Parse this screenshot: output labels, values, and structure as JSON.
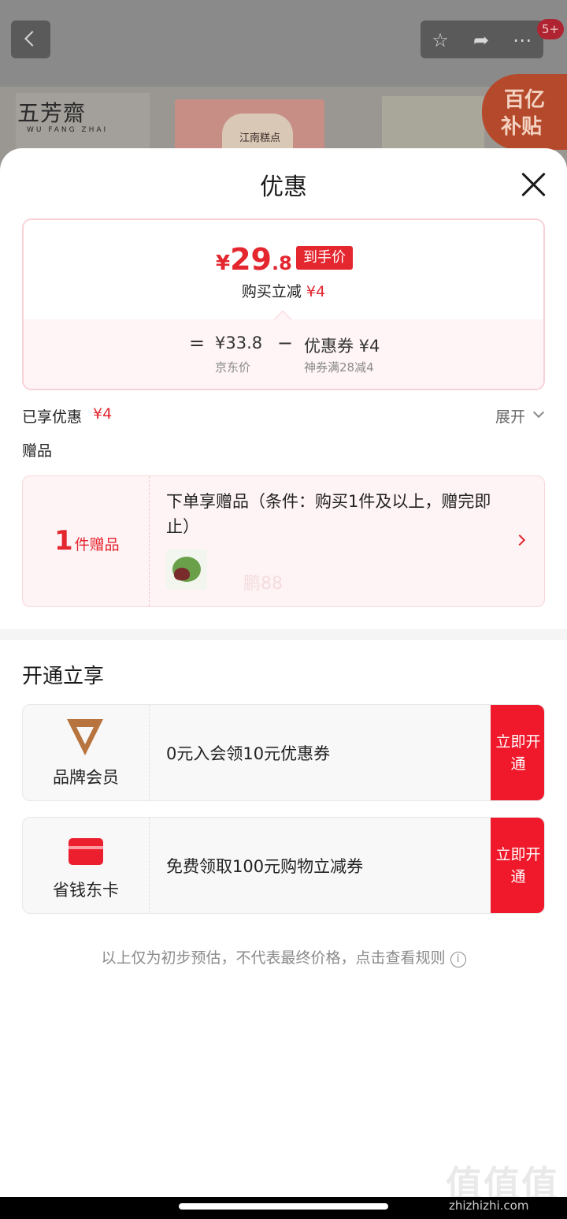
{
  "background": {
    "brand_logo": "五芳齋",
    "brand_logo_sub": "WU FANG ZHAI",
    "product_title": "江南糕点",
    "badge_count": "5+",
    "subsidy_line1": "百亿",
    "subsidy_line2": "补贴",
    "icons": [
      "back-chevron-icon",
      "star-icon",
      "share-icon",
      "more-icon"
    ]
  },
  "sheet": {
    "title": "优惠",
    "close_icon": "close-icon"
  },
  "price_card": {
    "currency": "¥",
    "final_int": "29",
    "final_dec": ".8",
    "final_tag": "到手价",
    "instant_label": "购买立减",
    "instant_amount": "¥4",
    "equals": "=",
    "original_price": "¥33.8",
    "original_label": "京东价",
    "minus": "−",
    "coupon_label": "优惠券 ¥4",
    "coupon_sub": "神券满28减4"
  },
  "summary": {
    "enjoyed_label": "已享优惠",
    "enjoyed_amount": "¥4",
    "expand_label": "展开"
  },
  "gift": {
    "section_label": "赠品",
    "count_number": "1",
    "count_text": "件赠品",
    "description": "下单享赠品（条件：购买1件及以上，赠完即止）",
    "watermark": "鹏88"
  },
  "open_section": {
    "title": "开通立享",
    "cards": [
      {
        "name": "品牌会员",
        "desc": "0元入会领10元优惠券",
        "button": "立即开通",
        "icon": "v-member-icon"
      },
      {
        "name": "省钱东卡",
        "desc": "免费领取100元购物立减券",
        "button": "立即开通",
        "icon": "red-card-icon"
      }
    ]
  },
  "disclaimer": "以上仅为初步预估，不代表最终价格，点击查看规则",
  "watermark_site": "值值值",
  "watermark_url": "zhizhizhi.com",
  "colors": {
    "accent_red": "#e4262f",
    "button_red": "#f0192b",
    "pink_bg": "#fff4f5"
  }
}
